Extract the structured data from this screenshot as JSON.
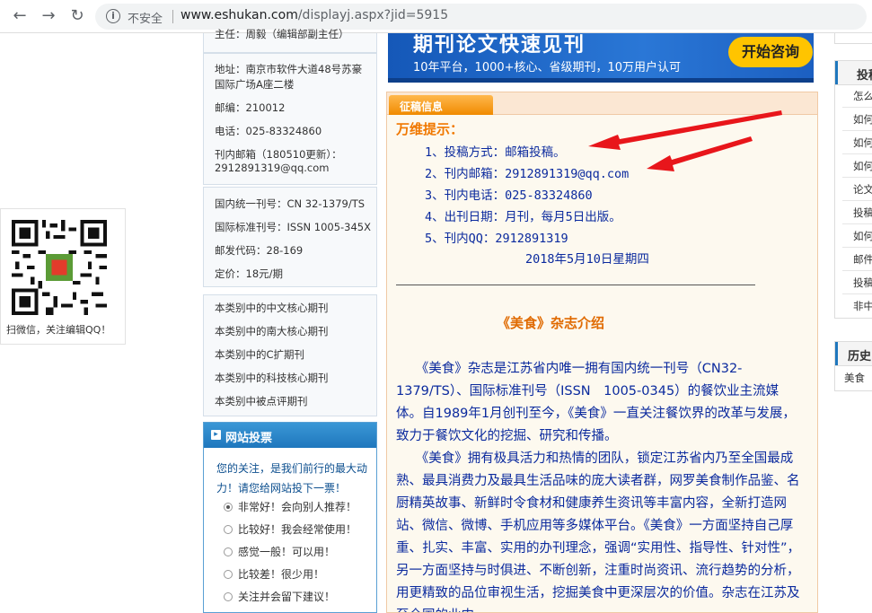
{
  "browser": {
    "insecure_label": "不安全",
    "url_host": "www.eshukan.com",
    "url_path": "/displayj.aspx?jid=5915"
  },
  "qr": {
    "caption": "扫微信，关注编辑QQ！"
  },
  "left": {
    "cut_text": "主任：周毅（编辑部副主任）",
    "address": [
      "地址：南京市软件大道48号苏豪",
      "国际广场A座二楼"
    ],
    "postcode": "邮编：210012",
    "phone": "电话：025-83324860",
    "email": [
      "刊内邮箱（180510更新）：",
      "2912891319@qq.com"
    ],
    "cn": "国内统一刊号：CN 32-1379/TS",
    "issn": "国际标准刊号：ISSN 1005-345X",
    "postal_code": "邮发代码：28-169",
    "price": "定价：18元/期",
    "categories": [
      "本类别中的中文核心期刊",
      "本类别中的南大核心期刊",
      "本类别中的C扩期刊",
      "本类别中的科技核心期刊",
      "本类别中被点评期刊"
    ]
  },
  "vote": {
    "title": "网站投票",
    "question": "您的关注，是我们前行的最大动力！请您给网站投下一票！",
    "options": [
      "非常好！会向别人推荐！",
      "比较好！我会经常使用！",
      "感觉一般！可以用！",
      "比较差！很少用！",
      "关注并会留下建议！"
    ]
  },
  "banner": {
    "title": "期刊论文快速见刊",
    "subtitle": "10年平台，1000+核心、省级期刊，10万用户认可",
    "button": "开始咨询"
  },
  "panel": {
    "tab": "征稿信息",
    "tip_title": "万维提示：",
    "tips": [
      "1、投稿方式：邮箱投稿。",
      "2、刊内邮箱：2912891319@qq.com",
      "3、刊内电话：025-83324860",
      "4、出刊日期：月刊，每月5日出版。",
      "5、刊内QQ：2912891319"
    ],
    "date": "2018年5月10日星期四",
    "intro_title": "《美食》杂志介绍",
    "para1": "　　《美食》杂志是江苏省内唯一拥有国内统一刊号（CN32-1379/TS）、国际标准刊号（ISSN　1005-0345）的餐饮业主流媒体。自1989年1月创刊至今，《美食》一直关注餐饮界的改革与发展，致力于餐饮文化的挖掘、研究和传播。",
    "para2": "　　《美食》拥有极具活力和热情的团队，锁定江苏省内乃至全国最成熟、最具消费力及最具生活品味的庞大读者群，网罗美食制作品鉴、名厨精英故事、新鲜时令食材和健康养生资讯等丰富内容，全新打造网站、微信、微博、手机应用等多媒体平台。《美食》一方面坚持自己厚重、扎实、丰富、实用的办刊理念，强调“实用性、指导性、针对性”，另一方面坚持与时俱进、不断创新，注重时尚资讯、流行趋势的分析，用更精致的品位审视生活，挖掘美食中更深层次的价值。杂志在江苏及至全国的业内"
  },
  "right": {
    "list_head": "投稿",
    "items": [
      "怎么",
      "如何",
      "如何",
      "如何",
      "论文",
      "投稿",
      "如何",
      "邮件",
      "投稿",
      "非中"
    ],
    "hist_head": "历史",
    "hist_item": "美食"
  },
  "colors": {
    "link_blue": "#0b2a9e",
    "accent_orange": "#f07800",
    "arrow_red": "#e8161b",
    "vote_blue": "#1f77bd"
  }
}
